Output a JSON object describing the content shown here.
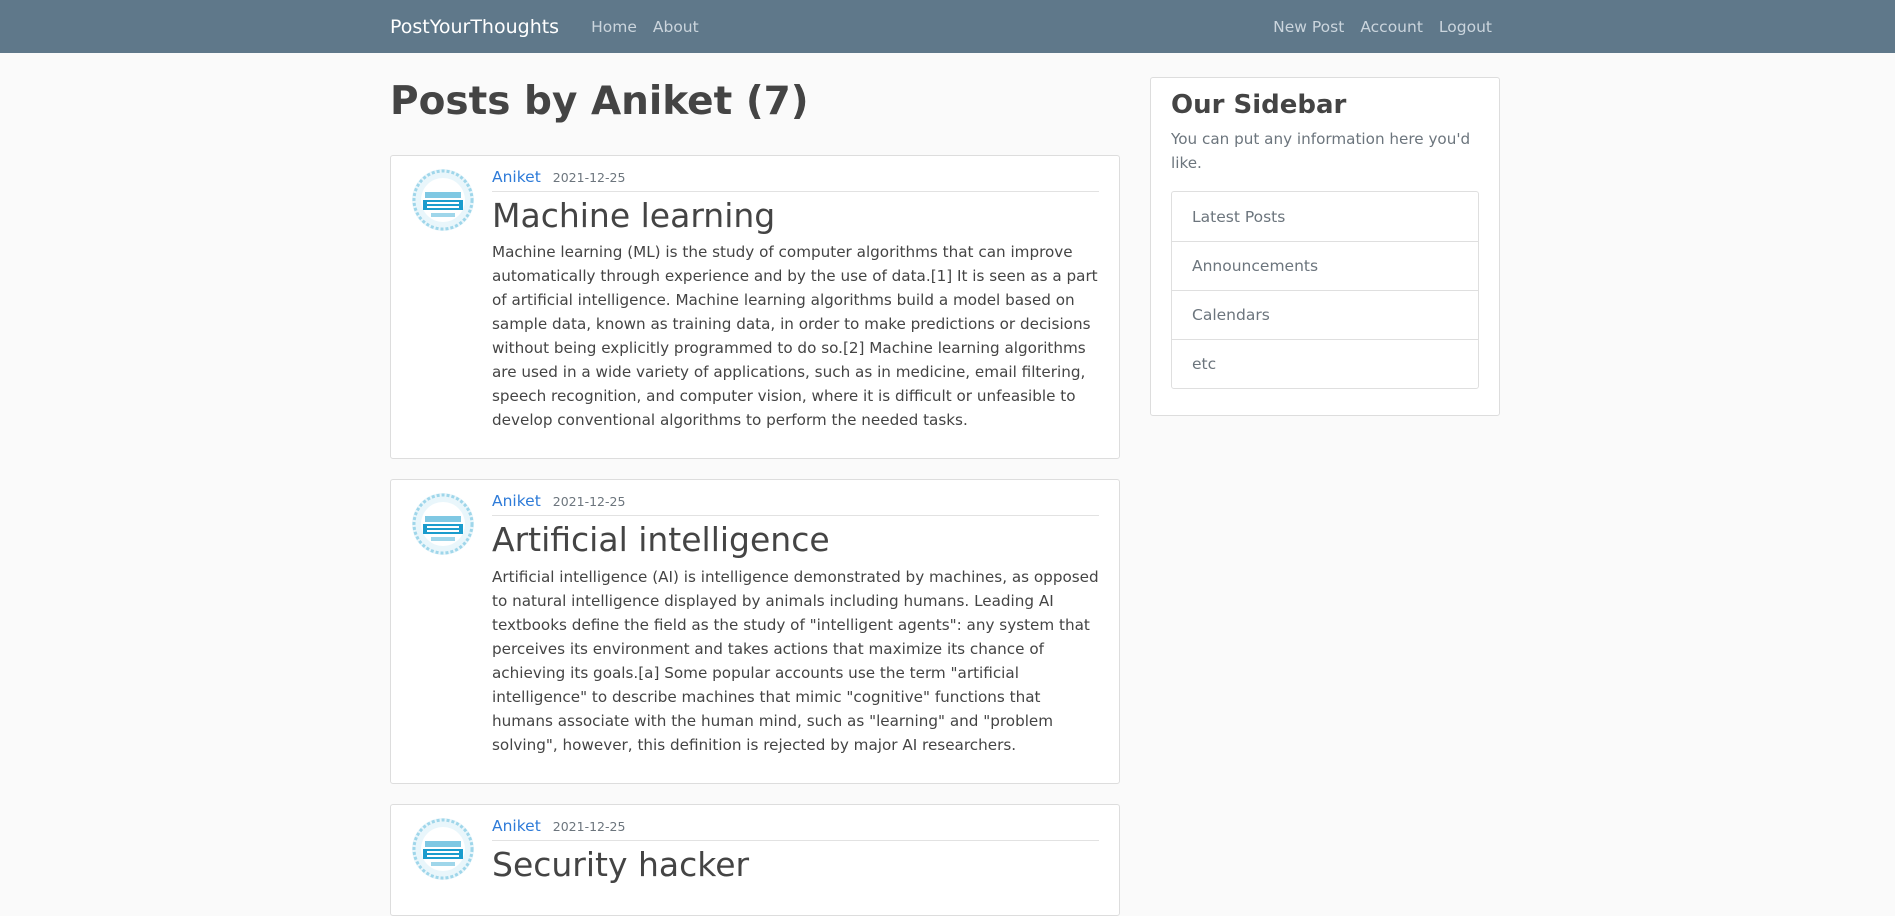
{
  "navbar": {
    "brand": "PostYourThoughts",
    "left_links": [
      "Home",
      "About"
    ],
    "right_links": [
      "New Post",
      "Account",
      "Logout"
    ]
  },
  "page": {
    "title": "Posts by Aniket (7)"
  },
  "posts": [
    {
      "author": "Aniket",
      "date": "2021-12-25",
      "title": "Machine learning",
      "content": "Machine learning (ML) is the study of computer algorithms that can improve automatically through experience and by the use of data.[1] It is seen as a part of artificial intelligence. Machine learning algorithms build a model based on sample data, known as training data, in order to make predictions or decisions without being explicitly programmed to do so.[2] Machine learning algorithms are used in a wide variety of applications, such as in medicine, email filtering, speech recognition, and computer vision, where it is difficult or unfeasible to develop conventional algorithms to perform the needed tasks.",
      "avatar_icon": "internet-of-things-avatar-icon"
    },
    {
      "author": "Aniket",
      "date": "2021-12-25",
      "title": "Artificial intelligence",
      "content": "Artificial intelligence (AI) is intelligence demonstrated by machines, as opposed to natural intelligence displayed by animals including humans. Leading AI textbooks define the field as the study of \"intelligent agents\": any system that perceives its environment and takes actions that maximize its chance of achieving its goals.[a] Some popular accounts use the term \"artificial intelligence\" to describe machines that mimic \"cognitive\" functions that humans associate with the human mind, such as \"learning\" and \"problem solving\", however, this definition is rejected by major AI researchers.",
      "avatar_icon": "internet-of-things-avatar-icon"
    },
    {
      "author": "Aniket",
      "date": "2021-12-25",
      "title": "Security hacker",
      "content": "",
      "avatar_icon": "internet-of-things-avatar-icon"
    }
  ],
  "sidebar": {
    "title": "Our Sidebar",
    "description": "You can put any information here you'd like.",
    "items": [
      "Latest Posts",
      "Announcements",
      "Calendars",
      "etc"
    ]
  },
  "colors": {
    "navbar_bg": "#5f788a",
    "link": "#2e7bd8",
    "page_bg": "#fafafa"
  }
}
